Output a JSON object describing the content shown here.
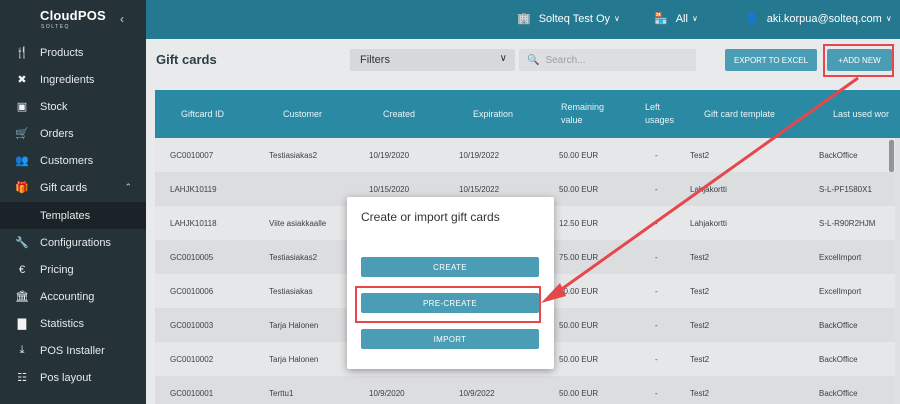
{
  "app": {
    "brand": "CloudPOS",
    "brand_sub": "SOLTEQ",
    "collapse_icon": "chevron-left-icon"
  },
  "topbar": {
    "company": "Solteq Test Oy",
    "store": "All",
    "user": "aki.korpua@solteq.com"
  },
  "sidebar": {
    "items": [
      {
        "label": "Products",
        "icon": "fork-knife-icon"
      },
      {
        "label": "Ingredients",
        "icon": "utensils-cross-icon"
      },
      {
        "label": "Stock",
        "icon": "warehouse-icon"
      },
      {
        "label": "Orders",
        "icon": "cart-icon"
      },
      {
        "label": "Customers",
        "icon": "users-icon"
      },
      {
        "label": "Gift cards",
        "icon": "gift-icon"
      },
      {
        "label": "Templates",
        "icon": ""
      },
      {
        "label": "Configurations",
        "icon": "wrench-icon"
      },
      {
        "label": "Pricing",
        "icon": "euro-icon"
      },
      {
        "label": "Accounting",
        "icon": "bank-icon"
      },
      {
        "label": "Statistics",
        "icon": "bar-chart-icon"
      },
      {
        "label": "POS Installer",
        "icon": "download-icon"
      },
      {
        "label": "Pos layout",
        "icon": "grid-icon"
      }
    ]
  },
  "header": {
    "title": "Gift cards",
    "filters_label": "Filters",
    "search_placeholder": "Search...",
    "export_label": "EXPORT TO EXCEL",
    "add_label": "+ADD NEW"
  },
  "table": {
    "columns": [
      "Giftcard ID",
      "Customer",
      "Created",
      "Expiration",
      "Remaining value",
      "Left usages",
      "Gift card template",
      "Last used wor"
    ],
    "rows": [
      [
        "GC0010007",
        "Testiasiakas2",
        "10/19/2020",
        "10/19/2022",
        "50.00 EUR",
        "-",
        "Test2",
        "BackOffice"
      ],
      [
        "LAHJK10119",
        "",
        "10/15/2020",
        "10/15/2022",
        "50.00 EUR",
        "-",
        "Lahjakortti",
        "S-L-PF1580X1"
      ],
      [
        "LAHJK10118",
        "Viite asiakkaalle",
        "",
        "",
        "12.50 EUR",
        "-",
        "Lahjakortti",
        "S-L-R90R2HJM"
      ],
      [
        "GC0010005",
        "Testiasiakas2",
        "",
        "",
        "75.00 EUR",
        "-",
        "Test2",
        "ExcelImport"
      ],
      [
        "GC0010006",
        "Testiasiakas",
        "",
        "",
        "60.00 EUR",
        "-",
        "Test2",
        "ExcelImport"
      ],
      [
        "GC0010003",
        "Tarja Halonen",
        "",
        "",
        "50.00 EUR",
        "-",
        "Test2",
        "BackOffice"
      ],
      [
        "GC0010002",
        "Tarja Halonen",
        "",
        "",
        "50.00 EUR",
        "-",
        "Test2",
        "BackOffice"
      ],
      [
        "GC0010001",
        "Terttu1",
        "10/9/2020",
        "10/9/2022",
        "50.00 EUR",
        "-",
        "Test2",
        "BackOffice"
      ]
    ]
  },
  "modal": {
    "title": "Create or import gift cards",
    "create_label": "CREATE",
    "precreate_label": "PRE-CREATE",
    "import_label": "IMPORT"
  },
  "colors": {
    "sidebar_bg": "#253238",
    "topbar_bg": "#24788f",
    "table_header_bg": "#2b8aa3",
    "button_bg": "#4a9db5",
    "annotation_red": "#e5474b"
  }
}
